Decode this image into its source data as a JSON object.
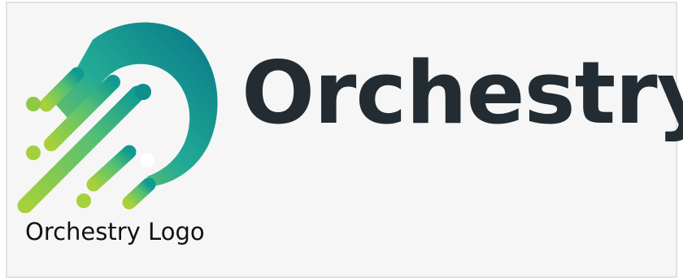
{
  "logo": {
    "wordmark": "Orchestry",
    "caption": "Orchestry Logo",
    "icon": "orchestry-comet-icon"
  },
  "colors": {
    "teal": "#0a7c88",
    "mid_teal": "#17a79a",
    "green": "#9acf3a",
    "wordmark": "#222c32",
    "background": "#f6f6f6",
    "border": "#e2e2e2"
  }
}
